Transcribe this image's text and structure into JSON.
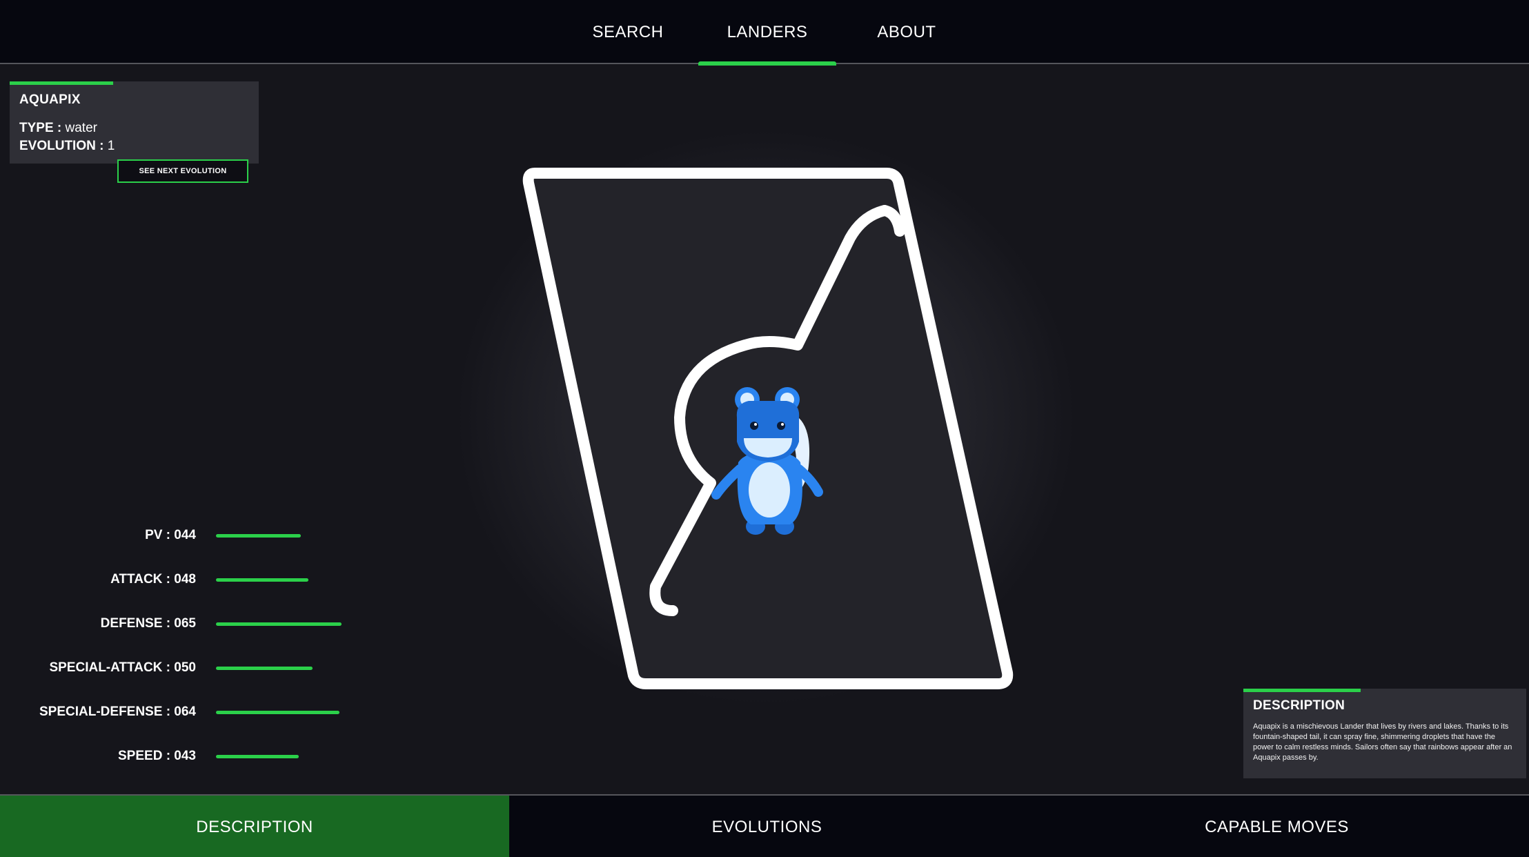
{
  "nav": {
    "items": [
      {
        "label": "SEARCH"
      },
      {
        "label": "LANDERS"
      },
      {
        "label": "ABOUT"
      }
    ],
    "active": "LANDERS"
  },
  "lander": {
    "name": "AQUAPIX",
    "type_label": "TYPE :",
    "type_value": "water",
    "evolution_label": "EVOLUTION :",
    "evolution_value": "1",
    "next_evolution_button": "SEE NEXT EVOLUTION"
  },
  "stats": [
    {
      "label": "PV : 044",
      "value": 44
    },
    {
      "label": "ATTACK : 048",
      "value": 48
    },
    {
      "label": "DEFENSE : 065",
      "value": 65
    },
    {
      "label": "SPECIAL-ATTACK : 050",
      "value": 50
    },
    {
      "label": "SPECIAL-DEFENSE : 064",
      "value": 64
    },
    {
      "label": "SPEED : 043",
      "value": 43
    }
  ],
  "description": {
    "title": "DESCRIPTION",
    "text": "Aquapix is a mischievous Lander that lives by rivers and lakes. Thanks to its fountain-shaped tail, it can spray fine, shimmering droplets that have the power to calm restless minds. Sailors often say that rainbows appear after an Aquapix passes by."
  },
  "bottom_tabs": [
    {
      "label": "DESCRIPTION"
    },
    {
      "label": "EVOLUTIONS"
    },
    {
      "label": "CAPABLE MOVES"
    }
  ],
  "colors": {
    "accent": "#2bd04a",
    "active_tab": "#186922",
    "nav_bg": "#06070f",
    "card_bg": "#2f2f36"
  }
}
